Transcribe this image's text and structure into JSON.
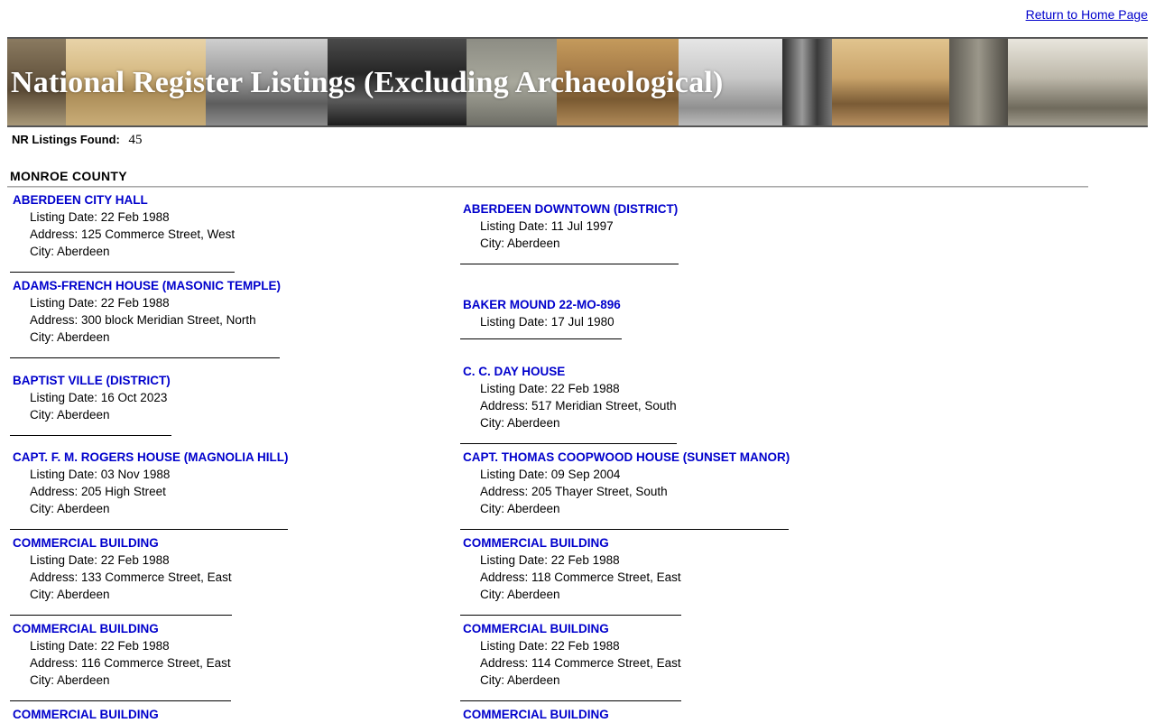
{
  "header": {
    "home_link": "Return to Home Page",
    "banner_title": "National Register Listings (Excluding Archaeological)"
  },
  "summary": {
    "found_label": "NR Listings Found:",
    "found_count": "45"
  },
  "county": "MONROE COUNTY",
  "listings": {
    "left": [
      {
        "name": "ABERDEEN CITY HALL",
        "date": "Listing Date: 22 Feb 1988",
        "address": "Address: 125 Commerce Street, West",
        "city": "City: Aberdeen"
      },
      {
        "name": "ADAMS-FRENCH HOUSE (MASONIC TEMPLE)",
        "date": "Listing Date: 22 Feb 1988",
        "address": "Address: 300 block Meridian Street, North",
        "city": "City: Aberdeen"
      },
      {
        "name": "BAPTIST VILLE (DISTRICT)",
        "date": "Listing Date: 16 Oct 2023",
        "city": "City: Aberdeen"
      },
      {
        "name": "CAPT. F. M. ROGERS HOUSE (MAGNOLIA HILL)",
        "date": "Listing Date: 03 Nov 1988",
        "address": "Address: 205 High Street",
        "city": "City: Aberdeen"
      },
      {
        "name": "COMMERCIAL BUILDING",
        "date": "Listing Date: 22 Feb 1988",
        "address": "Address: 133 Commerce Street, East",
        "city": "City: Aberdeen"
      },
      {
        "name": "COMMERCIAL BUILDING",
        "date": "Listing Date: 22 Feb 1988",
        "address": "Address: 116 Commerce Street, East",
        "city": "City: Aberdeen"
      },
      {
        "name": "COMMERCIAL BUILDING"
      }
    ],
    "right": [
      {
        "name": "ABERDEEN DOWNTOWN (DISTRICT)",
        "date": "Listing Date: 11 Jul 1997",
        "city": "City: Aberdeen"
      },
      {
        "name": "BAKER MOUND 22-MO-896",
        "date": "Listing Date: 17 Jul 1980"
      },
      {
        "name": "C. C. DAY HOUSE",
        "date": "Listing Date: 22 Feb 1988",
        "address": "Address: 517 Meridian Street, South",
        "city": "City: Aberdeen"
      },
      {
        "name": "CAPT. THOMAS COOPWOOD HOUSE (SUNSET MANOR)",
        "date": "Listing Date: 09 Sep 2004",
        "address": "Address: 205 Thayer Street, South",
        "city": "City: Aberdeen"
      },
      {
        "name": "COMMERCIAL BUILDING",
        "date": "Listing Date: 22 Feb 1988",
        "address": "Address: 118 Commerce Street, East",
        "city": "City: Aberdeen"
      },
      {
        "name": "COMMERCIAL BUILDING",
        "date": "Listing Date: 22 Feb 1988",
        "address": "Address: 114 Commerce Street, East",
        "city": "City: Aberdeen"
      },
      {
        "name": "COMMERCIAL BUILDING"
      }
    ]
  },
  "colors": {
    "link": "#0000cc",
    "banner_title": "#ffffff"
  }
}
